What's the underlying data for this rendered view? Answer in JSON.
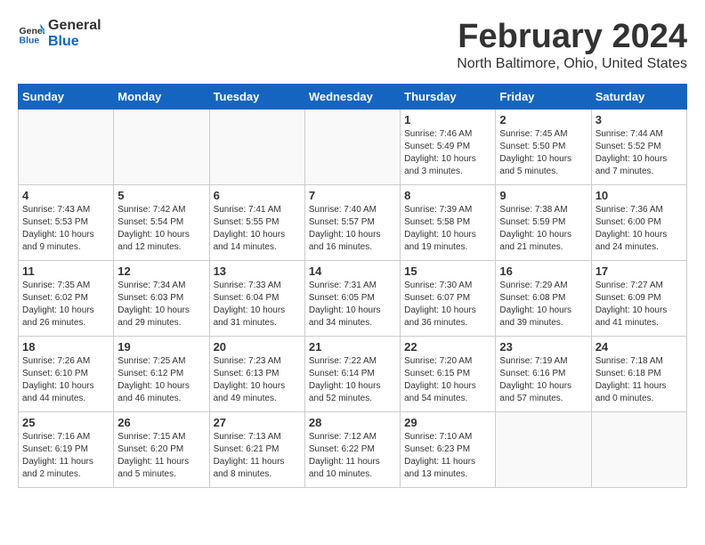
{
  "logo": {
    "general": "General",
    "blue": "Blue"
  },
  "header": {
    "title": "February 2024",
    "subtitle": "North Baltimore, Ohio, United States"
  },
  "weekdays": [
    "Sunday",
    "Monday",
    "Tuesday",
    "Wednesday",
    "Thursday",
    "Friday",
    "Saturday"
  ],
  "weeks": [
    [
      {
        "day": "",
        "info": ""
      },
      {
        "day": "",
        "info": ""
      },
      {
        "day": "",
        "info": ""
      },
      {
        "day": "",
        "info": ""
      },
      {
        "day": "1",
        "info": "Sunrise: 7:46 AM\nSunset: 5:49 PM\nDaylight: 10 hours\nand 3 minutes."
      },
      {
        "day": "2",
        "info": "Sunrise: 7:45 AM\nSunset: 5:50 PM\nDaylight: 10 hours\nand 5 minutes."
      },
      {
        "day": "3",
        "info": "Sunrise: 7:44 AM\nSunset: 5:52 PM\nDaylight: 10 hours\nand 7 minutes."
      }
    ],
    [
      {
        "day": "4",
        "info": "Sunrise: 7:43 AM\nSunset: 5:53 PM\nDaylight: 10 hours\nand 9 minutes."
      },
      {
        "day": "5",
        "info": "Sunrise: 7:42 AM\nSunset: 5:54 PM\nDaylight: 10 hours\nand 12 minutes."
      },
      {
        "day": "6",
        "info": "Sunrise: 7:41 AM\nSunset: 5:55 PM\nDaylight: 10 hours\nand 14 minutes."
      },
      {
        "day": "7",
        "info": "Sunrise: 7:40 AM\nSunset: 5:57 PM\nDaylight: 10 hours\nand 16 minutes."
      },
      {
        "day": "8",
        "info": "Sunrise: 7:39 AM\nSunset: 5:58 PM\nDaylight: 10 hours\nand 19 minutes."
      },
      {
        "day": "9",
        "info": "Sunrise: 7:38 AM\nSunset: 5:59 PM\nDaylight: 10 hours\nand 21 minutes."
      },
      {
        "day": "10",
        "info": "Sunrise: 7:36 AM\nSunset: 6:00 PM\nDaylight: 10 hours\nand 24 minutes."
      }
    ],
    [
      {
        "day": "11",
        "info": "Sunrise: 7:35 AM\nSunset: 6:02 PM\nDaylight: 10 hours\nand 26 minutes."
      },
      {
        "day": "12",
        "info": "Sunrise: 7:34 AM\nSunset: 6:03 PM\nDaylight: 10 hours\nand 29 minutes."
      },
      {
        "day": "13",
        "info": "Sunrise: 7:33 AM\nSunset: 6:04 PM\nDaylight: 10 hours\nand 31 minutes."
      },
      {
        "day": "14",
        "info": "Sunrise: 7:31 AM\nSunset: 6:05 PM\nDaylight: 10 hours\nand 34 minutes."
      },
      {
        "day": "15",
        "info": "Sunrise: 7:30 AM\nSunset: 6:07 PM\nDaylight: 10 hours\nand 36 minutes."
      },
      {
        "day": "16",
        "info": "Sunrise: 7:29 AM\nSunset: 6:08 PM\nDaylight: 10 hours\nand 39 minutes."
      },
      {
        "day": "17",
        "info": "Sunrise: 7:27 AM\nSunset: 6:09 PM\nDaylight: 10 hours\nand 41 minutes."
      }
    ],
    [
      {
        "day": "18",
        "info": "Sunrise: 7:26 AM\nSunset: 6:10 PM\nDaylight: 10 hours\nand 44 minutes."
      },
      {
        "day": "19",
        "info": "Sunrise: 7:25 AM\nSunset: 6:12 PM\nDaylight: 10 hours\nand 46 minutes."
      },
      {
        "day": "20",
        "info": "Sunrise: 7:23 AM\nSunset: 6:13 PM\nDaylight: 10 hours\nand 49 minutes."
      },
      {
        "day": "21",
        "info": "Sunrise: 7:22 AM\nSunset: 6:14 PM\nDaylight: 10 hours\nand 52 minutes."
      },
      {
        "day": "22",
        "info": "Sunrise: 7:20 AM\nSunset: 6:15 PM\nDaylight: 10 hours\nand 54 minutes."
      },
      {
        "day": "23",
        "info": "Sunrise: 7:19 AM\nSunset: 6:16 PM\nDaylight: 10 hours\nand 57 minutes."
      },
      {
        "day": "24",
        "info": "Sunrise: 7:18 AM\nSunset: 6:18 PM\nDaylight: 11 hours\nand 0 minutes."
      }
    ],
    [
      {
        "day": "25",
        "info": "Sunrise: 7:16 AM\nSunset: 6:19 PM\nDaylight: 11 hours\nand 2 minutes."
      },
      {
        "day": "26",
        "info": "Sunrise: 7:15 AM\nSunset: 6:20 PM\nDaylight: 11 hours\nand 5 minutes."
      },
      {
        "day": "27",
        "info": "Sunrise: 7:13 AM\nSunset: 6:21 PM\nDaylight: 11 hours\nand 8 minutes."
      },
      {
        "day": "28",
        "info": "Sunrise: 7:12 AM\nSunset: 6:22 PM\nDaylight: 11 hours\nand 10 minutes."
      },
      {
        "day": "29",
        "info": "Sunrise: 7:10 AM\nSunset: 6:23 PM\nDaylight: 11 hours\nand 13 minutes."
      },
      {
        "day": "",
        "info": ""
      },
      {
        "day": "",
        "info": ""
      }
    ]
  ]
}
